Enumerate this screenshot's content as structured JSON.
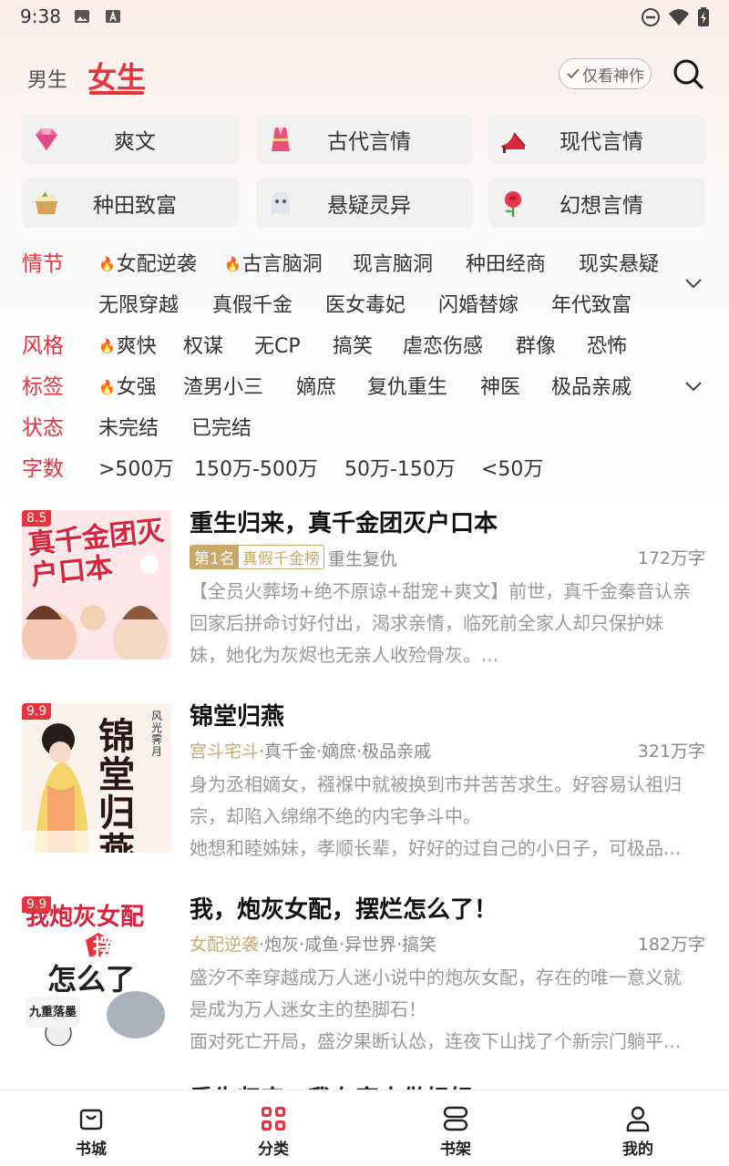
{
  "status_bar": {
    "time": "9:38"
  },
  "header": {
    "tabs": [
      {
        "label": "男生",
        "active": false
      },
      {
        "label": "女生",
        "active": true
      }
    ],
    "only_god_label": "仅看神作"
  },
  "categories": [
    {
      "label": "爽文",
      "icon": "diamond-icon"
    },
    {
      "label": "古代言情",
      "icon": "hanfu-icon"
    },
    {
      "label": "现代言情",
      "icon": "high-heel-icon"
    },
    {
      "label": "种田致富",
      "icon": "rice-basket-icon"
    },
    {
      "label": "悬疑灵异",
      "icon": "ghost-icon"
    },
    {
      "label": "幻想言情",
      "icon": "rose-icon"
    }
  ],
  "filters": {
    "plot": {
      "label": "情节",
      "chips": [
        "女配逆袭",
        "古言脑洞",
        "现言脑洞",
        "种田经商",
        "现实悬疑",
        "无限穿越",
        "真假千金",
        "医女毒妃",
        "闪婚替嫁",
        "年代致富"
      ]
    },
    "style": {
      "label": "风格",
      "chips": [
        "爽快",
        "权谋",
        "无CP",
        "搞笑",
        "虐恋伤感",
        "群像",
        "恐怖"
      ]
    },
    "tags": {
      "label": "标签",
      "chips": [
        "女强",
        "渣男小三",
        "嫡庶",
        "复仇重生",
        "神医",
        "极品亲戚"
      ]
    },
    "status": {
      "label": "状态",
      "chips": [
        "未完结",
        "已完结"
      ]
    },
    "words": {
      "label": "字数",
      "chips": [
        ">500万",
        "150万-500万",
        "50万-150万",
        "<50万"
      ]
    }
  },
  "books": [
    {
      "score": "8.5",
      "title": "重生归来，真千金团灭户口本",
      "rank_no": "第1名",
      "rank_list": "真假千金榜",
      "tags": "重生复仇",
      "words": "172万字",
      "desc": [
        "【全员火葬场+绝不原谅+甜宠+爽文】前世，真千金秦音认亲",
        "回家后拼命讨好付出，渴求亲情，临死前全家人却只保护妹",
        "妹，她化为灰烬也无亲人收殓骨灰。..."
      ],
      "cover_text": "真千金团灭户口本"
    },
    {
      "score": "9.9",
      "title": "锦堂归燕",
      "primary_tag": "宫斗宅斗",
      "tags": "·真千金·嫡庶·极品亲戚",
      "words": "321万字",
      "desc": [
        "身为丞相嫡女，襁褓中就被换到市井苦苦求生。好容易认祖归",
        "宗，却陷入绵绵不绝的内宅争斗中。",
        "她想和睦姊妹，孝顺长辈，好好的过自己的小日子，可极品..."
      ],
      "cover_text": "锦堂归燕",
      "cover_author": "风光霁月"
    },
    {
      "score": "9.9",
      "title": "我，炮灰女配，摆烂怎么了！",
      "primary_tag": "女配逆袭",
      "tags": "·炮灰·咸鱼·异世界·搞笑",
      "words": "182万字",
      "desc": [
        "盛汐不幸穿越成万人迷小说中的炮灰女配，存在的唯一意义就",
        "是成为万人迷女主的垫脚石！",
        "面对死亡开局，盛汐果断认怂，连夜下山找了个新宗门躺平..."
      ],
      "cover_text_1": "我炮灰女配",
      "cover_text_2": "摆烂",
      "cover_text_3": "怎么了",
      "cover_author": "九重落墨"
    }
  ],
  "next_book_title": "重生归来，我在家中做妈妈",
  "bottom_nav": [
    {
      "label": "书城",
      "icon": "bag-icon",
      "active": false
    },
    {
      "label": "分类",
      "icon": "grid-icon",
      "active": true
    },
    {
      "label": "书架",
      "icon": "shelf-icon",
      "active": false
    },
    {
      "label": "我的",
      "icon": "person-icon",
      "active": false
    }
  ],
  "colors": {
    "accent": "#e8323c",
    "gold": "#c9a86b"
  }
}
